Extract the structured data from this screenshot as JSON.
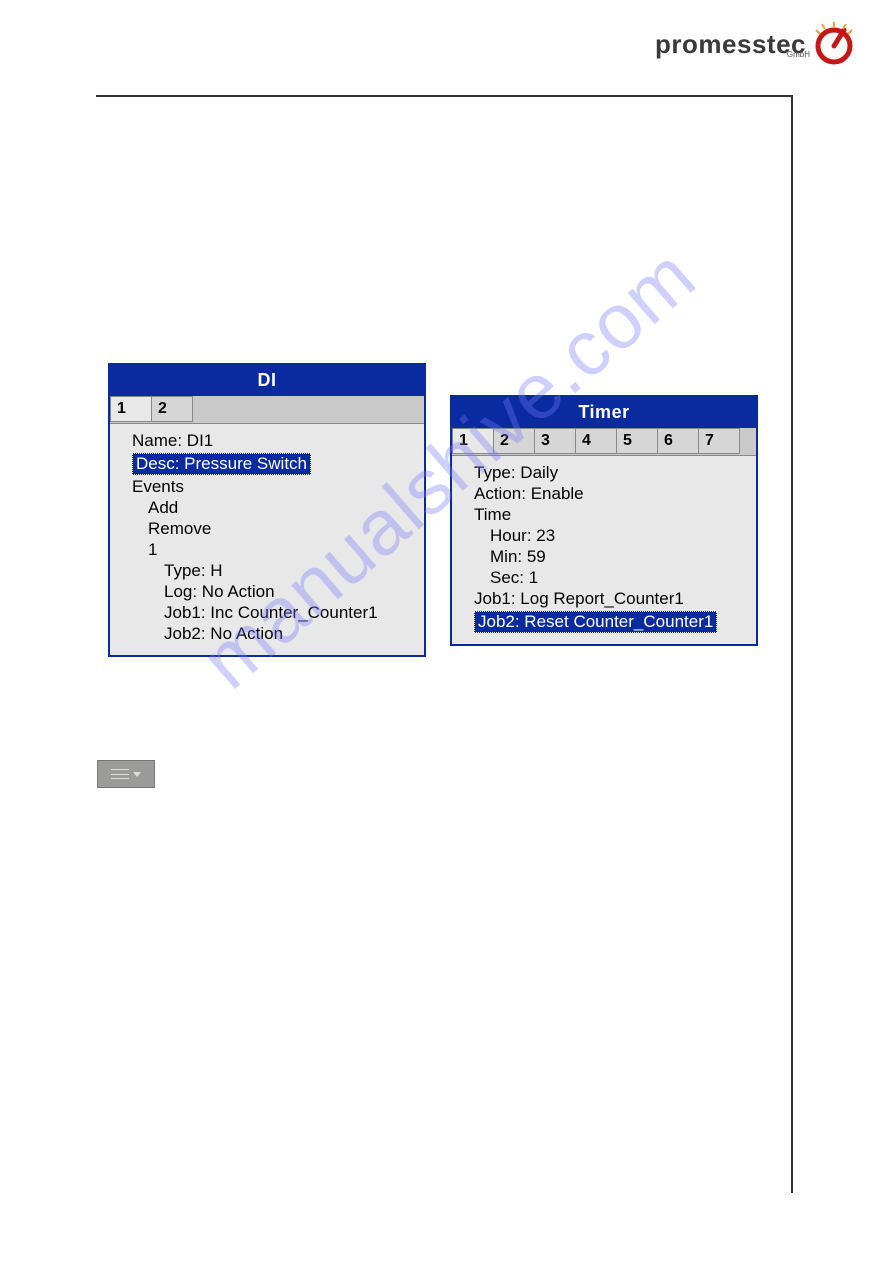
{
  "logo": {
    "text": "promesstec",
    "sub": "GmbH"
  },
  "watermark": "manualshive.com",
  "di": {
    "title": "DI",
    "tabs": [
      "1",
      "2"
    ],
    "active_tab": 0,
    "name": "Name: DI1",
    "desc": "Desc: Pressure Switch",
    "events": "Events",
    "add": "Add",
    "remove": "Remove",
    "event_num": "1",
    "type": "Type: H",
    "log": "Log: No Action",
    "job1": "Job1: Inc Counter_Counter1",
    "job2": "Job2: No Action"
  },
  "timer": {
    "title": "Timer",
    "tabs": [
      "1",
      "2",
      "3",
      "4",
      "5",
      "6",
      "7"
    ],
    "active_tab": 0,
    "type": "Type: Daily",
    "action": "Action: Enable",
    "time": "Time",
    "hour": "Hour: 23",
    "min": "Min: 59",
    "sec": "Sec: 1",
    "job1": "Job1: Log Report_Counter1",
    "job2": "Job2: Reset Counter_Counter1"
  }
}
